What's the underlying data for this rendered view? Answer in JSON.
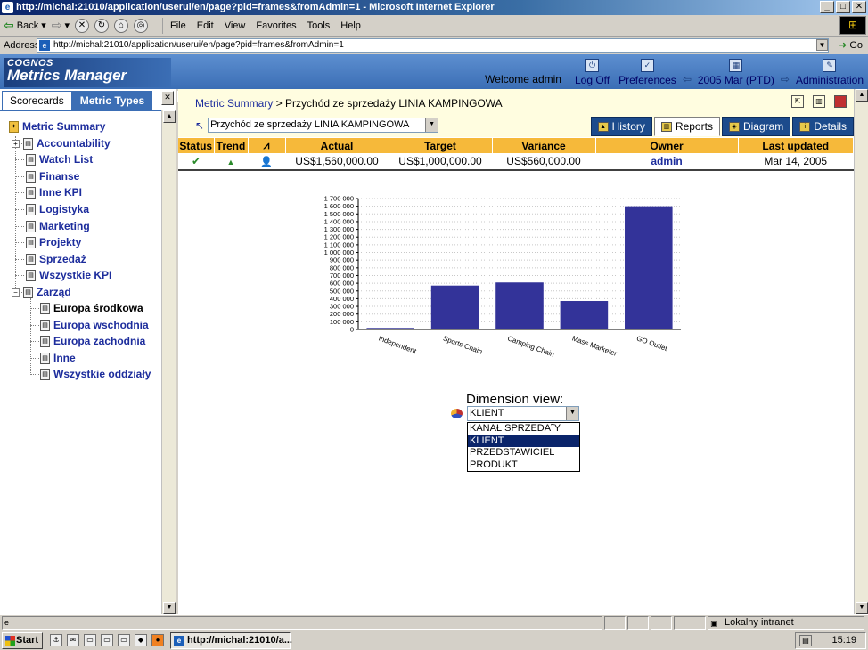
{
  "window": {
    "title": "http://michal:21010/application/userui/en/page?pid=frames&fromAdmin=1 - Microsoft Internet Explorer",
    "minimize_icon": "minimize-icon",
    "maximize_icon": "maximize-icon",
    "close_icon": "close-icon"
  },
  "toolbar": {
    "back_label": "Back",
    "menu": [
      "File",
      "Edit",
      "View",
      "Favorites",
      "Tools",
      "Help"
    ]
  },
  "address": {
    "label": "Address",
    "url": "http://michal:21010/application/userui/en/page?pid=frames&fromAdmin=1",
    "go_label": "Go"
  },
  "app": {
    "brand_top": "COGNOS",
    "brand_name": "Metrics Manager",
    "welcome": "Welcome admin",
    "nav": {
      "logoff": "Log Off",
      "preferences": "Preferences",
      "period": "2005 Mar (PTD)",
      "administration": "Administration"
    }
  },
  "sidebar": {
    "tab_scorecards": "Scorecards",
    "tab_metric_types": "Metric Types",
    "tree": [
      {
        "label": "Metric Summary"
      },
      {
        "label": "Accountability"
      },
      {
        "label": "Watch List"
      },
      {
        "label": "Finanse"
      },
      {
        "label": "Inne KPI"
      },
      {
        "label": "Logistyka"
      },
      {
        "label": "Marketing"
      },
      {
        "label": "Projekty"
      },
      {
        "label": "Sprzedaż"
      },
      {
        "label": "Wszystkie KPI"
      },
      {
        "label": "Zarząd"
      },
      {
        "label": "Europa środkowa"
      },
      {
        "label": "Europa wschodnia"
      },
      {
        "label": "Europa zachodnia"
      },
      {
        "label": "Inne"
      },
      {
        "label": "Wszystkie oddziały"
      }
    ]
  },
  "main": {
    "breadcrumb_link": "Metric Summary",
    "breadcrumb_sep": ">",
    "breadcrumb_current": "Przychód ze sprzedaży LINIA KAMPINGOWA",
    "metric_select": "Przychód ze sprzedaży LINIA KAMPINGOWA",
    "tabs": {
      "history": "History",
      "reports": "Reports",
      "diagram": "Diagram",
      "details": "Details"
    },
    "table": {
      "headers": [
        "Status",
        "Trend",
        "",
        "Actual",
        "Target",
        "Variance",
        "Owner",
        "Last updated"
      ],
      "row": {
        "actual": "US$1,560,000.00",
        "target": "US$1,000,000.00",
        "variance": "US$560,000.00",
        "owner": "admin",
        "last_updated": "Mar 14, 2005"
      }
    },
    "dimension": {
      "label": "Dimension view:",
      "selected": "KLIENT",
      "options": [
        "KANAŁ SPRZEDA˜Y",
        "KLIENT",
        "PRZEDSTAWICIEL",
        "PRODUKT"
      ]
    }
  },
  "chart_data": {
    "type": "bar",
    "categories": [
      "Independent",
      "Sports Chain",
      "Camping Chain",
      "Mass Marketer",
      "GO Outlet"
    ],
    "values": [
      20000,
      570000,
      610000,
      370000,
      1600000
    ],
    "ylim": [
      0,
      1700000
    ],
    "ytick_step": 100000,
    "yticks": [
      "0",
      "100 000",
      "200 000",
      "300 000",
      "400 000",
      "500 000",
      "600 000",
      "700 000",
      "800 000",
      "900 000",
      "1 000 000",
      "1 100 000",
      "1 200 000",
      "1 300 000",
      "1 400 000",
      "1 500 000",
      "1 600 000",
      "1 700 000"
    ],
    "bar_color": "#333399",
    "grid": true
  },
  "statusbar": {
    "zone": "Lokalny intranet"
  },
  "taskbar": {
    "start": "Start",
    "task": "http://michal:21010/a...",
    "clock": "15:19"
  }
}
